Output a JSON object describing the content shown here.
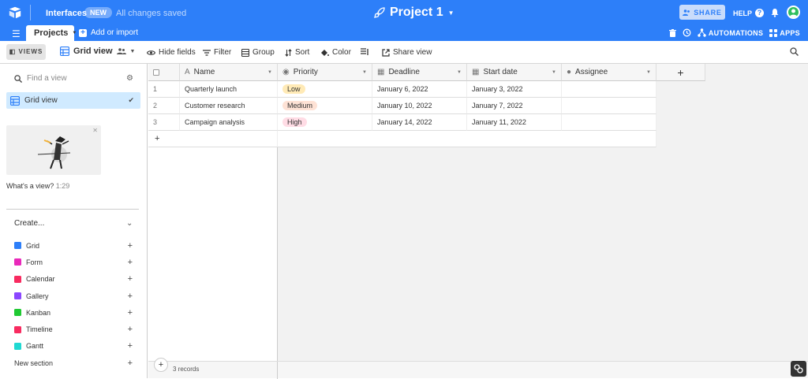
{
  "topbar": {
    "interfaces": "Interfaces",
    "badge": "NEW",
    "saved": "All changes saved",
    "title": "Project 1",
    "share": "SHARE",
    "help": "HELP"
  },
  "tabbar": {
    "tab": "Projects",
    "add": "Add or import",
    "automations": "AUTOMATIONS",
    "apps": "APPS"
  },
  "toolbar": {
    "views": "VIEWS",
    "grid_view": "Grid view",
    "hide_fields": "Hide fields",
    "filter": "Filter",
    "group": "Group",
    "sort": "Sort",
    "color": "Color",
    "share_view": "Share view"
  },
  "sidebar": {
    "find_placeholder": "Find a view",
    "current_view": "Grid view",
    "whats_a_view": "What's a view?",
    "video_time": "1:29",
    "create": "Create...",
    "view_types": [
      {
        "label": "Grid",
        "color": "#2d7ff9"
      },
      {
        "label": "Form",
        "color": "#e929ba"
      },
      {
        "label": "Calendar",
        "color": "#f82b60"
      },
      {
        "label": "Gallery",
        "color": "#8b46ff"
      },
      {
        "label": "Kanban",
        "color": "#20c933"
      },
      {
        "label": "Timeline",
        "color": "#f82b60"
      },
      {
        "label": "Gantt",
        "color": "#20d9d2"
      }
    ],
    "new_section": "New section"
  },
  "table": {
    "columns": [
      "Name",
      "Priority",
      "Deadline",
      "Start date",
      "Assignee"
    ],
    "rows": [
      {
        "num": "1",
        "name": "Quarterly launch",
        "priority": "Low",
        "deadline": "January 6, 2022",
        "start": "January 3, 2022",
        "assignee": ""
      },
      {
        "num": "2",
        "name": "Customer research",
        "priority": "Medium",
        "deadline": "January 10, 2022",
        "start": "January 7, 2022",
        "assignee": ""
      },
      {
        "num": "3",
        "name": "Campaign analysis",
        "priority": "High",
        "deadline": "January 14, 2022",
        "start": "January 11, 2022",
        "assignee": ""
      }
    ],
    "priority_colors": {
      "Low": "#ffeab6",
      "Medium": "#fee2d5",
      "High": "#ffdce5"
    },
    "record_count": "3 records"
  }
}
